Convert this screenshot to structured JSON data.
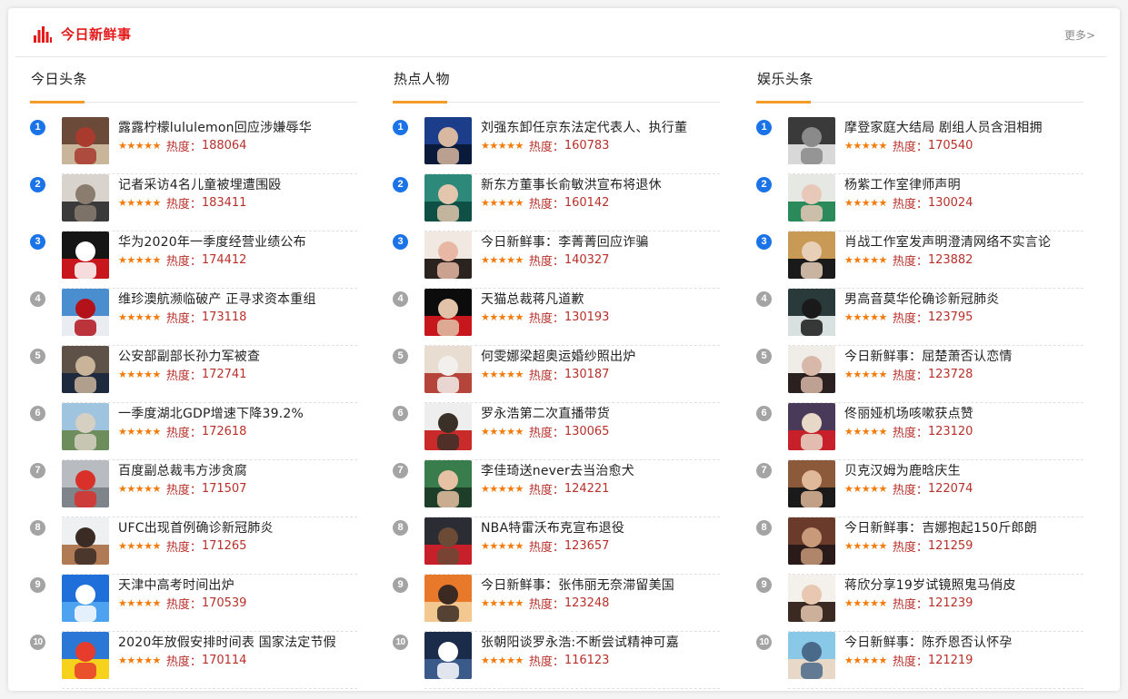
{
  "header": {
    "title": "今日新鲜事",
    "more": "更多>"
  },
  "colors": {
    "accent": "#e4191a",
    "underline": "#f39c27",
    "rank_top": "#1a74e8",
    "rank_rest": "#a4a4a4",
    "stars": "#f27b0d",
    "heat": "#b8302a"
  },
  "stars_display": "★★★★★",
  "heat_label": "热度：",
  "columns": [
    {
      "title": "今日头条",
      "items": [
        {
          "rank": "1",
          "title": "露露柠檬lululemon回应涉嫌辱华",
          "heat": "188064",
          "thumb": [
            "#6b4a3a",
            "#c8b59a",
            "#a83a2e"
          ]
        },
        {
          "rank": "2",
          "title": "记者采访4名儿童被埋遭围殴",
          "heat": "183411",
          "thumb": [
            "#d8d3cc",
            "#3a3a3a",
            "#8a7d70"
          ]
        },
        {
          "rank": "3",
          "title": "华为2020年一季度经营业绩公布",
          "heat": "174412",
          "thumb": [
            "#151515",
            "#c8161d",
            "#ffffff"
          ]
        },
        {
          "rank": "4",
          "title": "维珍澳航濒临破产 正寻求资本重组",
          "heat": "173118",
          "thumb": [
            "#4a8ed0",
            "#e9edf2",
            "#b3121b"
          ]
        },
        {
          "rank": "5",
          "title": "公安部副部长孙力军被查",
          "heat": "172741",
          "thumb": [
            "#5d5148",
            "#1d2a3e",
            "#c9b49a"
          ]
        },
        {
          "rank": "6",
          "title": "一季度湖北GDP增速下降39.2%",
          "heat": "172618",
          "thumb": [
            "#9fc4e0",
            "#6d8e5c",
            "#d6d0c2"
          ]
        },
        {
          "rank": "7",
          "title": "百度副总裁韦方涉贪腐",
          "heat": "171507",
          "thumb": [
            "#b8bcc0",
            "#7e848a",
            "#d9302a"
          ]
        },
        {
          "rank": "8",
          "title": "UFC出现首例确诊新冠肺炎",
          "heat": "171265",
          "thumb": [
            "#eef0f2",
            "#b07a55",
            "#3a2c24"
          ]
        },
        {
          "rank": "9",
          "title": "天津中高考时间出炉",
          "heat": "170539",
          "thumb": [
            "#1e6fd9",
            "#4da3f0",
            "#ffffff"
          ]
        },
        {
          "rank": "10",
          "title": "2020年放假安排时间表 国家法定节假",
          "heat": "170114",
          "thumb": [
            "#2b77d6",
            "#f7d21c",
            "#e63c2e"
          ]
        }
      ]
    },
    {
      "title": "热点人物",
      "items": [
        {
          "rank": "1",
          "title": "刘强东卸任京东法定代表人、执行董",
          "heat": "160783",
          "thumb": [
            "#1b3d8a",
            "#0a1a3a",
            "#d8b8a0"
          ]
        },
        {
          "rank": "2",
          "title": "新东方董事长俞敏洪宣布将退休",
          "heat": "160142",
          "thumb": [
            "#2d8a7a",
            "#0e4f46",
            "#e3c6ad"
          ]
        },
        {
          "rank": "3",
          "title": "今日新鲜事：李菁菁回应诈骗",
          "heat": "140327",
          "thumb": [
            "#f1e8e2",
            "#2a2320",
            "#e8b8a5"
          ]
        },
        {
          "rank": "4",
          "title": "天猫总裁蒋凡道歉",
          "heat": "130193",
          "thumb": [
            "#0c0c0c",
            "#c8161d",
            "#e0c3a8"
          ]
        },
        {
          "rank": "5",
          "title": "何雯娜梁超奥运婚纱照出炉",
          "heat": "130187",
          "thumb": [
            "#e8ddd0",
            "#b5453a",
            "#f2f0ec"
          ]
        },
        {
          "rank": "6",
          "title": "罗永浩第二次直播带货",
          "heat": "130065",
          "thumb": [
            "#eeeeee",
            "#c92a2a",
            "#3a3028"
          ]
        },
        {
          "rank": "7",
          "title": "李佳琦送never去当治愈犬",
          "heat": "124221",
          "thumb": [
            "#3a7d4d",
            "#1d3f2a",
            "#e6c1a3"
          ]
        },
        {
          "rank": "8",
          "title": "NBA特雷沃布克宣布退役",
          "heat": "123657",
          "thumb": [
            "#2c2c34",
            "#c8202a",
            "#6b4a36"
          ]
        },
        {
          "rank": "9",
          "title": "今日新鲜事：张伟丽无奈滞留美国",
          "heat": "123248",
          "thumb": [
            "#e8782a",
            "#f3c890",
            "#3a2a22"
          ]
        },
        {
          "rank": "10",
          "title": "张朝阳谈罗永浩:不断尝试精神可嘉",
          "heat": "116123",
          "thumb": [
            "#1b2b4a",
            "#3a5a8a",
            "#ffffff"
          ]
        }
      ]
    },
    {
      "title": "娱乐头条",
      "items": [
        {
          "rank": "1",
          "title": "摩登家庭大结局 剧组人员含泪相拥",
          "heat": "170540",
          "thumb": [
            "#3a3a3a",
            "#d8d8d8",
            "#8a8a8a"
          ]
        },
        {
          "rank": "2",
          "title": "杨紫工作室律师声明",
          "heat": "130024",
          "thumb": [
            "#e6e8e4",
            "#2a8a5a",
            "#e8c8b8"
          ]
        },
        {
          "rank": "3",
          "title": "肖战工作室发声明澄清网络不实言论",
          "heat": "123882",
          "thumb": [
            "#c89a55",
            "#1a1a1a",
            "#e8d0b8"
          ]
        },
        {
          "rank": "4",
          "title": "男高音莫华伦确诊新冠肺炎",
          "heat": "123795",
          "thumb": [
            "#2a3a3a",
            "#d8e0e0",
            "#1a1a1a"
          ]
        },
        {
          "rank": "5",
          "title": "今日新鲜事：屈楚萧否认恋情",
          "heat": "123728",
          "thumb": [
            "#f0ece8",
            "#2a2020",
            "#d8b8a8"
          ]
        },
        {
          "rank": "6",
          "title": "佟丽娅机场咳嗽获点赞",
          "heat": "123120",
          "thumb": [
            "#4a3a5a",
            "#c8202a",
            "#e8d8c8"
          ]
        },
        {
          "rank": "7",
          "title": "贝克汉姆为鹿晗庆生",
          "heat": "122074",
          "thumb": [
            "#8a5a3a",
            "#1a1a1a",
            "#e0b89a"
          ]
        },
        {
          "rank": "8",
          "title": "今日新鲜事：吉娜抱起150斤郎朗",
          "heat": "121259",
          "thumb": [
            "#6a3a2a",
            "#2a1a1a",
            "#c89a7a"
          ]
        },
        {
          "rank": "9",
          "title": "蒋欣分享19岁试镜照鬼马俏皮",
          "heat": "121239",
          "thumb": [
            "#f4f0ec",
            "#3a2a22",
            "#e8c8b0"
          ]
        },
        {
          "rank": "10",
          "title": "今日新鲜事：陈乔恩否认怀孕",
          "heat": "121219",
          "thumb": [
            "#8ac8e8",
            "#e8d8c8",
            "#4a6a8a"
          ]
        }
      ]
    }
  ]
}
